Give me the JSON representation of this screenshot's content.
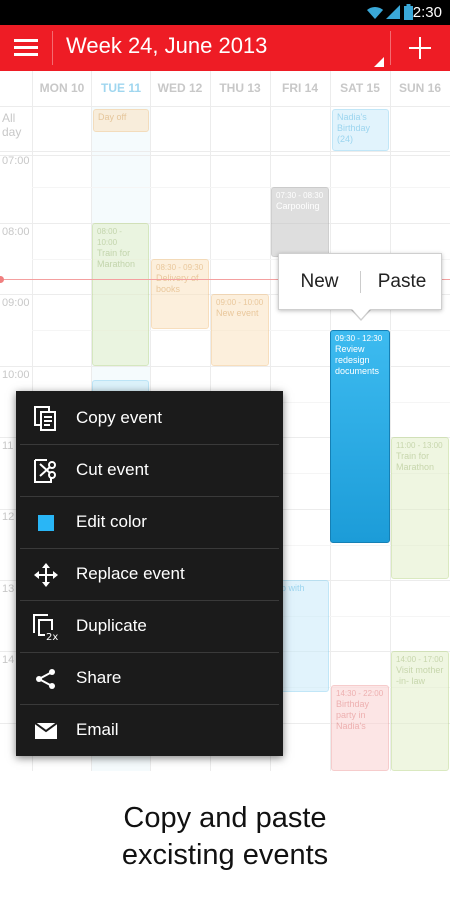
{
  "status_bar": {
    "time": "2:30"
  },
  "action_bar": {
    "title": "Week 24, June 2013",
    "menu_icon": "hamburger-icon",
    "add_icon": "plus-icon"
  },
  "days": [
    {
      "label": "MON 10"
    },
    {
      "label": "TUE 11"
    },
    {
      "label": "WED 12"
    },
    {
      "label": "THU 13"
    },
    {
      "label": "FRI 14"
    },
    {
      "label": "SAT 15"
    },
    {
      "label": "SUN 16"
    }
  ],
  "all_day_label": "All day",
  "time_labels": [
    "07:00",
    "08:00",
    "09:00",
    "10:00",
    "11",
    "12",
    "13",
    "14"
  ],
  "all_day_events": [
    {
      "title": "Day off"
    },
    {
      "title": "Nadia's Birthday (24)"
    }
  ],
  "events": [
    {
      "time": "07:30 - 08:30",
      "title": "Carpooling"
    },
    {
      "time": "08:00 - 10:00",
      "title": "Train for Marathon"
    },
    {
      "time": "08:30 - 09:30",
      "title": "Delivery of books"
    },
    {
      "time": "09:00 - 10:00",
      "title": "New event"
    },
    {
      "time": "09:30 - 12:30",
      "title": "Review redesign documents"
    },
    {
      "time": "11:00 - 13:00",
      "title": "Train for Marathon"
    },
    {
      "time": "",
      "title": "ub with"
    },
    {
      "time": "14:00 - 17:00",
      "title": "Visit mother -in- law"
    },
    {
      "time": "14:30 - 22:00",
      "title": "Birthday party in Nadia's"
    }
  ],
  "popup": {
    "new_label": "New",
    "paste_label": "Paste"
  },
  "context_menu": [
    {
      "label": "Copy event",
      "icon": "copy-icon"
    },
    {
      "label": "Cut event",
      "icon": "cut-icon"
    },
    {
      "label": "Edit color",
      "icon": "color-square-icon"
    },
    {
      "label": "Replace event",
      "icon": "move-arrows-icon"
    },
    {
      "label": "Duplicate",
      "icon": "duplicate-icon"
    },
    {
      "label": "Share",
      "icon": "share-icon"
    },
    {
      "label": "Email",
      "icon": "email-icon"
    }
  ],
  "caption": {
    "line1": "Copy and paste",
    "line2": "excisting events"
  },
  "colors": {
    "accent": "#ee1c25",
    "selected_event": "#29a8e0",
    "menu_bg": "#1b1b1b",
    "edit_color_swatch": "#29b6f6"
  }
}
